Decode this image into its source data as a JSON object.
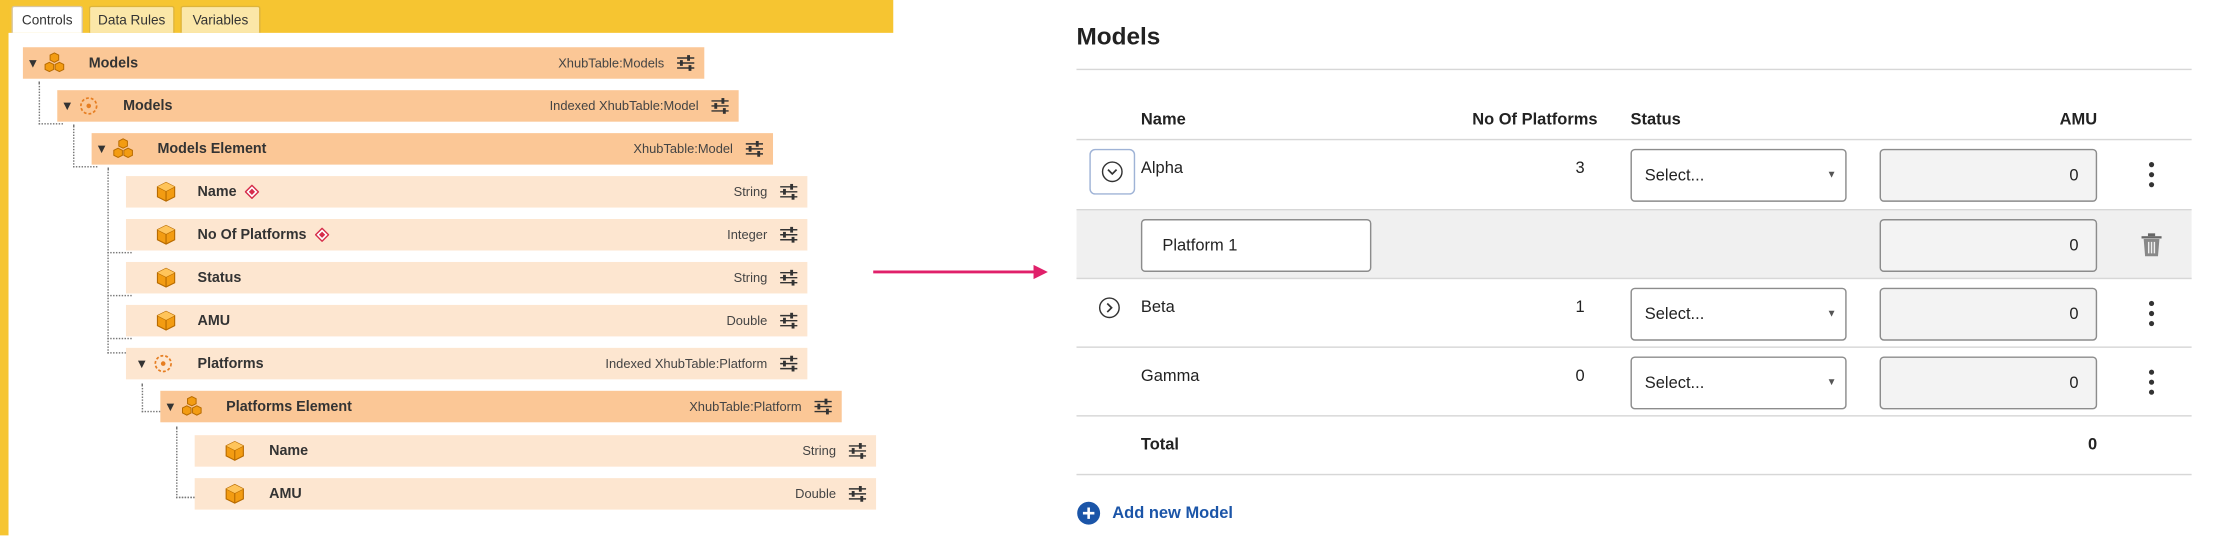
{
  "tabs": [
    {
      "label": "Controls",
      "active": true
    },
    {
      "label": "Data Rules",
      "active": false
    },
    {
      "label": "Variables",
      "active": false
    }
  ],
  "tree": {
    "models": {
      "name": "Models",
      "type": "XhubTable:Models"
    },
    "models_list": {
      "name": "Models",
      "type": "Indexed XhubTable:Model"
    },
    "models_element": {
      "name": "Models Element",
      "type": "XhubTable:Model"
    },
    "name": {
      "name": "Name",
      "type": "String",
      "required": true
    },
    "no_of_platforms": {
      "name": "No Of Platforms",
      "type": "Integer",
      "required": true
    },
    "status": {
      "name": "Status",
      "type": "String"
    },
    "amu": {
      "name": "AMU",
      "type": "Double"
    },
    "platforms": {
      "name": "Platforms",
      "type": "Indexed XhubTable:Platform"
    },
    "platforms_element": {
      "name": "Platforms Element",
      "type": "XhubTable:Platform"
    },
    "platform_name": {
      "name": "Name",
      "type": "String"
    },
    "platform_amu": {
      "name": "AMU",
      "type": "Double"
    }
  },
  "form": {
    "title": "Models",
    "headers": {
      "name": "Name",
      "platforms": "No Of Platforms",
      "status": "Status",
      "amu": "AMU"
    },
    "rows": [
      {
        "name": "Alpha",
        "platforms": "3",
        "status": "Select...",
        "amu": "0",
        "expanded": true
      },
      {
        "name": "Beta",
        "platforms": "1",
        "status": "Select...",
        "amu": "0",
        "expanded": false
      },
      {
        "name": "Gamma",
        "platforms": "0",
        "status": "Select...",
        "amu": "0"
      }
    ],
    "subrow": {
      "platform_name": "Platform 1",
      "amu": "0"
    },
    "total": {
      "label": "Total",
      "value": "0"
    },
    "add_label": "Add new Model"
  },
  "colors": {
    "tab_bar": "#f6c531",
    "container_row": "#fbc796",
    "leaf_row": "#fde6d0",
    "arrow": "#e0206a",
    "link": "#1b55a8"
  },
  "icons": [
    "cube-stack-icon",
    "indexed-list-icon",
    "cube-icon",
    "required-diamond-icon",
    "settings-sliders-icon",
    "expand-chevron-icon",
    "kebab-menu-icon",
    "trash-icon",
    "add-circle-icon",
    "arrow-right-icon"
  ]
}
